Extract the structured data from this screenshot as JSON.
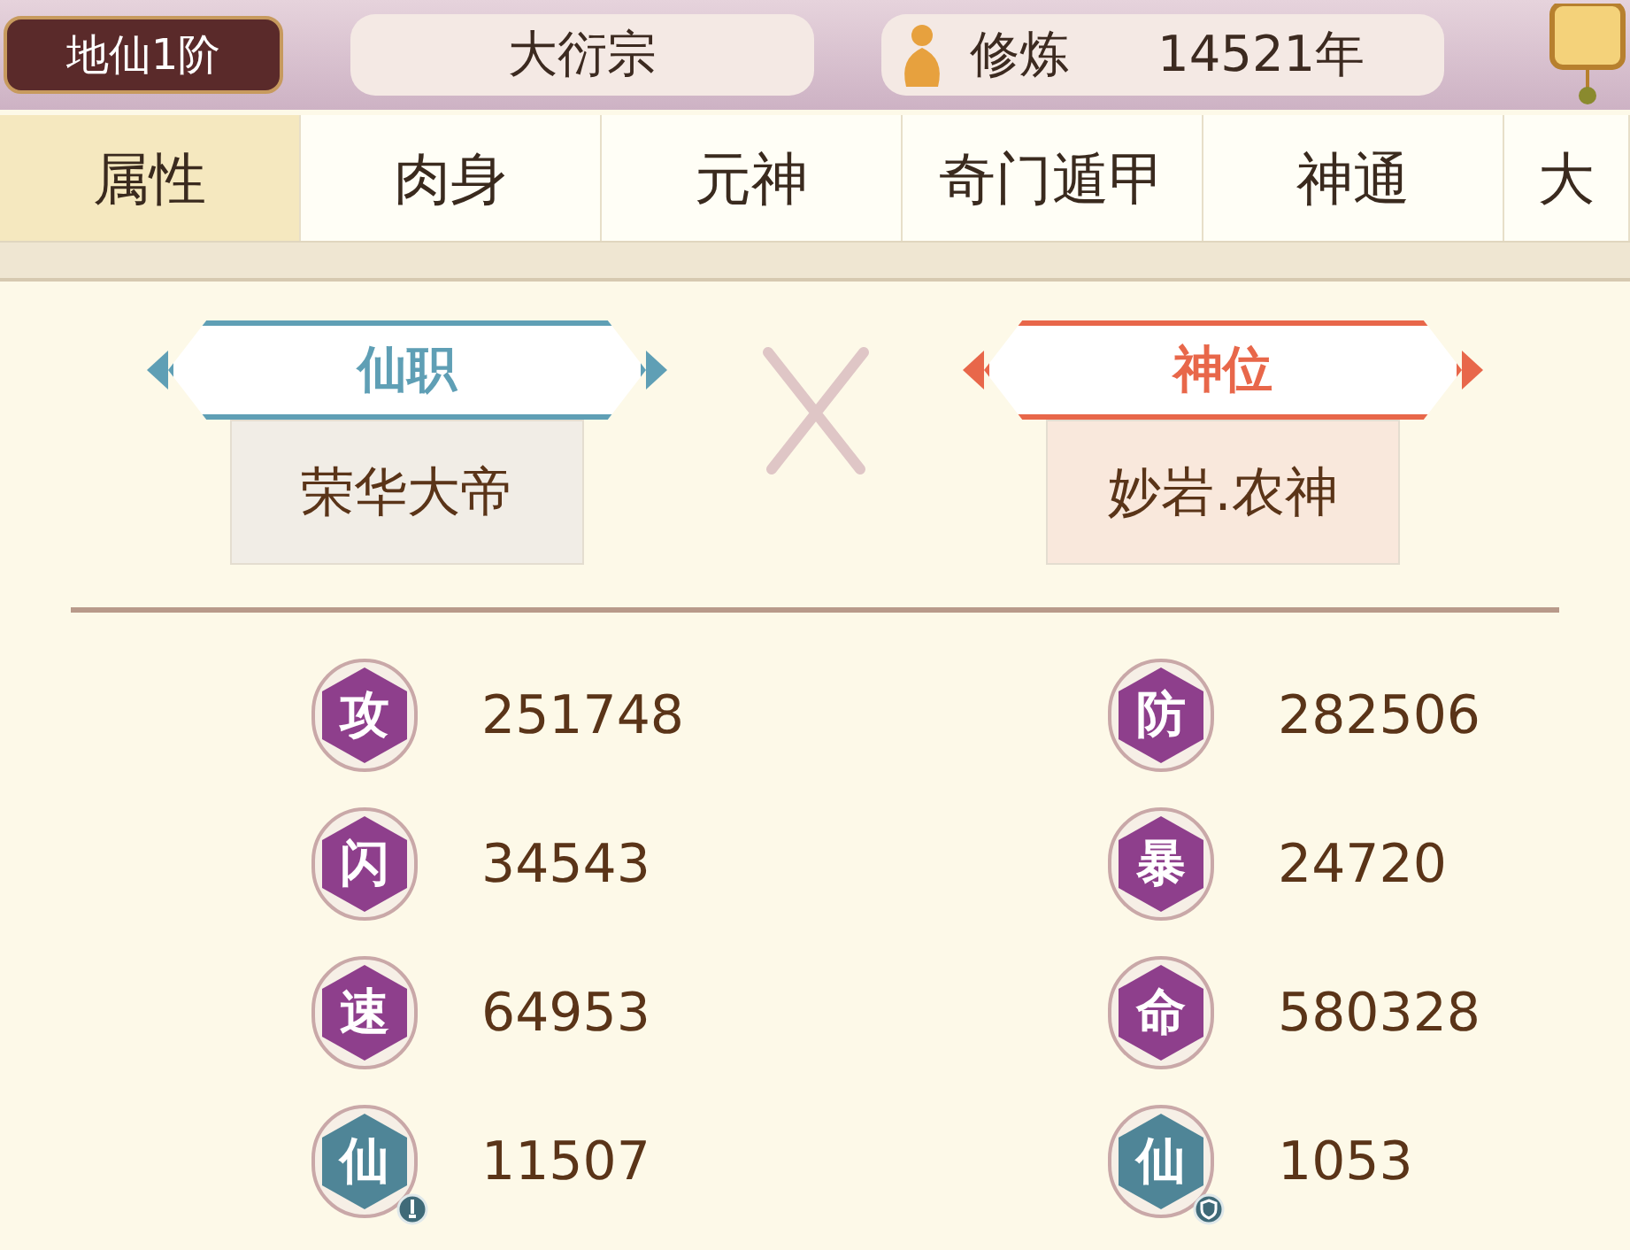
{
  "header": {
    "rank": "地仙1阶",
    "sect": "大衍宗",
    "cultivation_label": "修炼",
    "cultivation_years": "14521年"
  },
  "tabs": [
    {
      "label": "属性",
      "selected": true
    },
    {
      "label": "肉身",
      "selected": false
    },
    {
      "label": "元神",
      "selected": false
    },
    {
      "label": "奇门遁甲",
      "selected": false
    },
    {
      "label": "神通",
      "selected": false
    },
    {
      "label": "大",
      "selected": false
    }
  ],
  "titles": [
    {
      "heading": "仙职",
      "value": "荣华大帝",
      "color": "#5f9fb5"
    },
    {
      "heading": "神位",
      "value": "妙岩.农神",
      "color": "#e8674a"
    }
  ],
  "stats": [
    {
      "glyph": "攻",
      "value": "251748",
      "color": "#8e3f8c",
      "kind": "basic"
    },
    {
      "glyph": "防",
      "value": "282506",
      "color": "#8e3f8c",
      "kind": "basic"
    },
    {
      "glyph": "闪",
      "value": "34543",
      "color": "#8e3f8c",
      "kind": "basic"
    },
    {
      "glyph": "暴",
      "value": "24720",
      "color": "#8e3f8c",
      "kind": "basic"
    },
    {
      "glyph": "速",
      "value": "64953",
      "color": "#8e3f8c",
      "kind": "basic"
    },
    {
      "glyph": "命",
      "value": "580328",
      "color": "#8e3f8c",
      "kind": "basic"
    },
    {
      "glyph": "仙",
      "value": "11507",
      "color": "#4f8597",
      "kind": "attack"
    },
    {
      "glyph": "仙",
      "value": "1053",
      "color": "#4f8597",
      "kind": "defense"
    }
  ]
}
